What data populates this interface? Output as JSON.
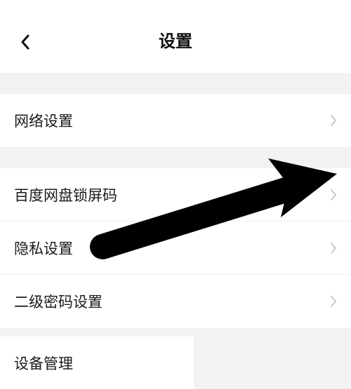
{
  "header": {
    "title": "设置"
  },
  "rows": {
    "network": "网络设置",
    "lockscreen": "百度网盘锁屏码",
    "privacy": "隐私设置",
    "secondary_pw": "二级密码设置",
    "device": "设备管理"
  }
}
